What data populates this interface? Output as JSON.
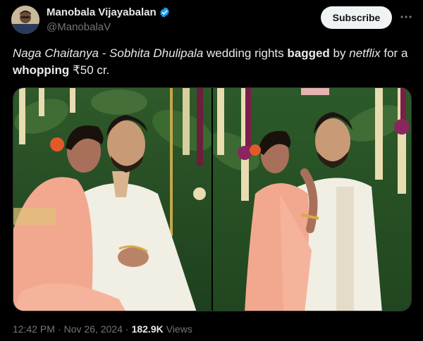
{
  "author": {
    "name": "Manobala Vijayabalan",
    "handle": "@ManobalaV",
    "verified": true,
    "badge_color": "#1d9bf0"
  },
  "subscribe_label": "Subscribe",
  "tweet": {
    "part1": "Naga Chaitanya - Sobhita Dhulipala",
    "part2": " wedding rights ",
    "part3": "bagged",
    "part4": " by ",
    "part5": "netflix",
    "part6": " for a ",
    "part7": "whopping",
    "part8": " ₹50 cr."
  },
  "meta": {
    "time": "12:42 PM",
    "sep1": "·",
    "date": "Nov 26, 2024",
    "sep2": "·",
    "views": "182.9K",
    "views_label": "Views"
  },
  "colors": {
    "background": "#000000",
    "text": "#e7e9ea",
    "muted": "#71767b"
  }
}
